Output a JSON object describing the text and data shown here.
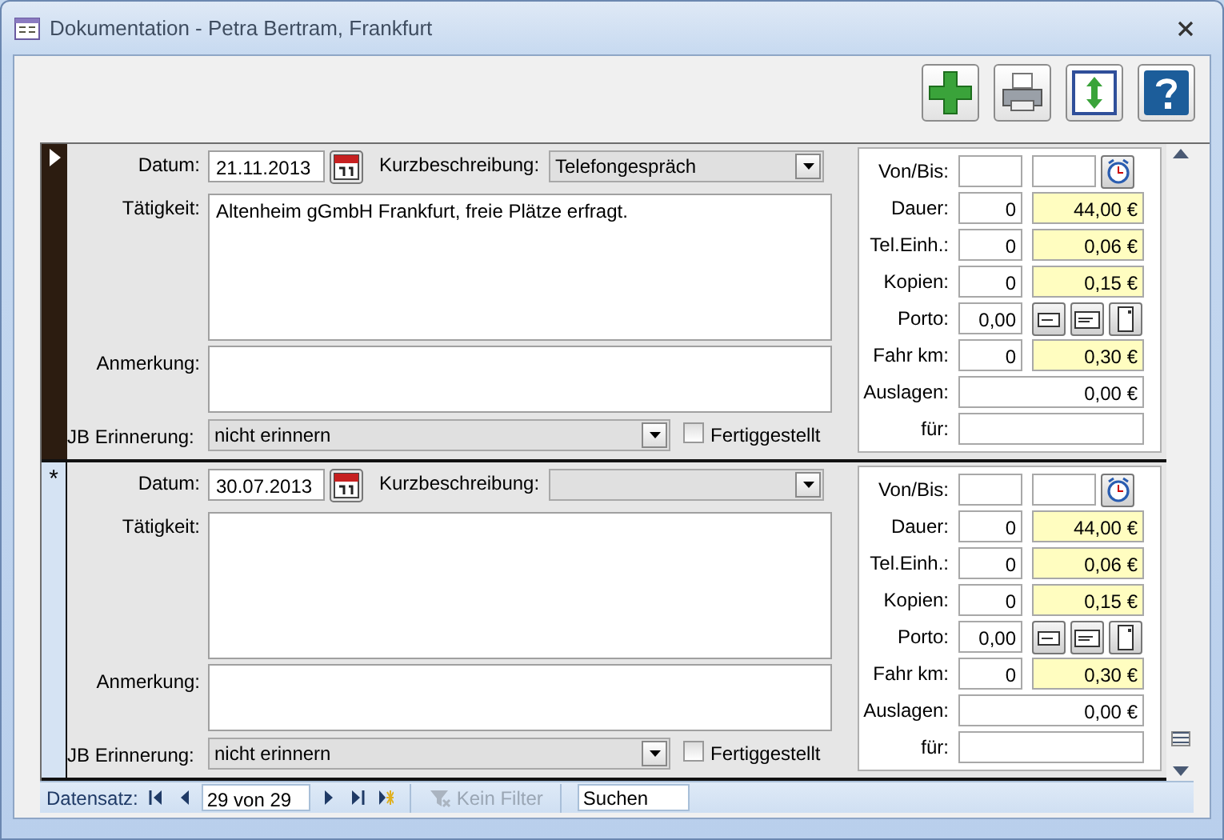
{
  "window": {
    "title": "Dokumentation - Petra Bertram, Frankfurt"
  },
  "toolbar": [
    {
      "kind": "add"
    },
    {
      "kind": "print"
    },
    {
      "kind": "resize"
    },
    {
      "kind": "help"
    }
  ],
  "records": [
    {
      "selector": {
        "kind": "current"
      },
      "datum_label": "Datum:",
      "datum": "21.11.2013",
      "kurz_label": "Kurzbeschreibung:",
      "kurz": "Telefongespräch",
      "taetigkeit_label": "Tätigkeit:",
      "taetigkeit": "Altenheim gGmbH Frankfurt, freie Plätze erfragt.",
      "anmerkung_label": "Anmerkung:",
      "erinnerung_label": "JB Erinnerung:",
      "erinnerung": "nicht erinnern",
      "fertig_label": "Fertiggestellt",
      "fertig_checked": false,
      "panel": [
        {
          "kind": "times",
          "label": "Von/Bis:"
        },
        {
          "kind": "cost",
          "label": "Dauer:",
          "count": "0",
          "amount": "44,00 €"
        },
        {
          "kind": "cost",
          "label": "Tel.Einh.:",
          "count": "0",
          "amount": "0,06 €"
        },
        {
          "kind": "cost",
          "label": "Kopien:",
          "count": "0",
          "amount": "0,15 €"
        },
        {
          "kind": "porto",
          "label": "Porto:",
          "count": "0,00"
        },
        {
          "kind": "cost",
          "label": "Fahr km:",
          "count": "0",
          "amount": "0,30 €"
        },
        {
          "kind": "total",
          "label": "Auslagen:",
          "amount": "0,00 €"
        },
        {
          "kind": "text",
          "label": "für:"
        }
      ]
    },
    {
      "selector": {
        "kind": "new",
        "symbol": "*"
      },
      "datum_label": "Datum:",
      "datum": "30.07.2013",
      "kurz_label": "Kurzbeschreibung:",
      "taetigkeit_label": "Tätigkeit:",
      "anmerkung_label": "Anmerkung:",
      "erinnerung_label": "JB Erinnerung:",
      "erinnerung": "nicht erinnern",
      "fertig_label": "Fertiggestellt",
      "fertig_checked": false,
      "panel": [
        {
          "kind": "times",
          "label": "Von/Bis:"
        },
        {
          "kind": "cost",
          "label": "Dauer:",
          "count": "0",
          "amount": "44,00 €"
        },
        {
          "kind": "cost",
          "label": "Tel.Einh.:",
          "count": "0",
          "amount": "0,06 €"
        },
        {
          "kind": "cost",
          "label": "Kopien:",
          "count": "0",
          "amount": "0,15 €"
        },
        {
          "kind": "porto",
          "label": "Porto:",
          "count": "0,00"
        },
        {
          "kind": "cost",
          "label": "Fahr km:",
          "count": "0",
          "amount": "0,30 €"
        },
        {
          "kind": "total",
          "label": "Auslagen:",
          "amount": "0,00 €"
        },
        {
          "kind": "text",
          "label": "für:"
        }
      ]
    }
  ],
  "navigation": {
    "label": "Datensatz:",
    "position": "29 von 29",
    "filter": "Kein Filter",
    "filter_disabled": true,
    "search_placeholder": "Suchen"
  }
}
